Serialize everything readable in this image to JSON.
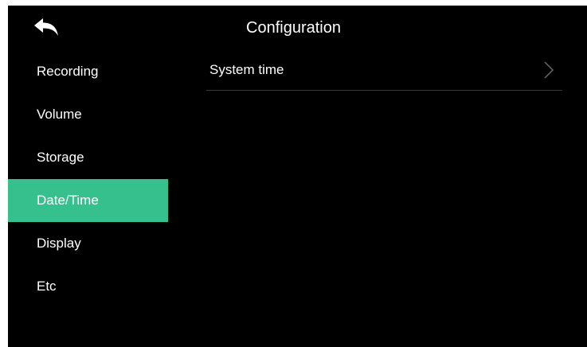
{
  "header": {
    "title": "Configuration",
    "back_icon": "back-arrow-icon"
  },
  "sidebar": {
    "active_index": 3,
    "items": [
      {
        "label": "Recording"
      },
      {
        "label": "Volume"
      },
      {
        "label": "Storage"
      },
      {
        "label": "Date/Time"
      },
      {
        "label": "Display"
      },
      {
        "label": "Etc"
      }
    ]
  },
  "content": {
    "rows": [
      {
        "label": "System time",
        "icon": "chevron-right-icon"
      }
    ]
  },
  "colors": {
    "background": "#000000",
    "accent": "#36c08e",
    "text": "#ffffff",
    "divider": "#3a3a3a"
  }
}
